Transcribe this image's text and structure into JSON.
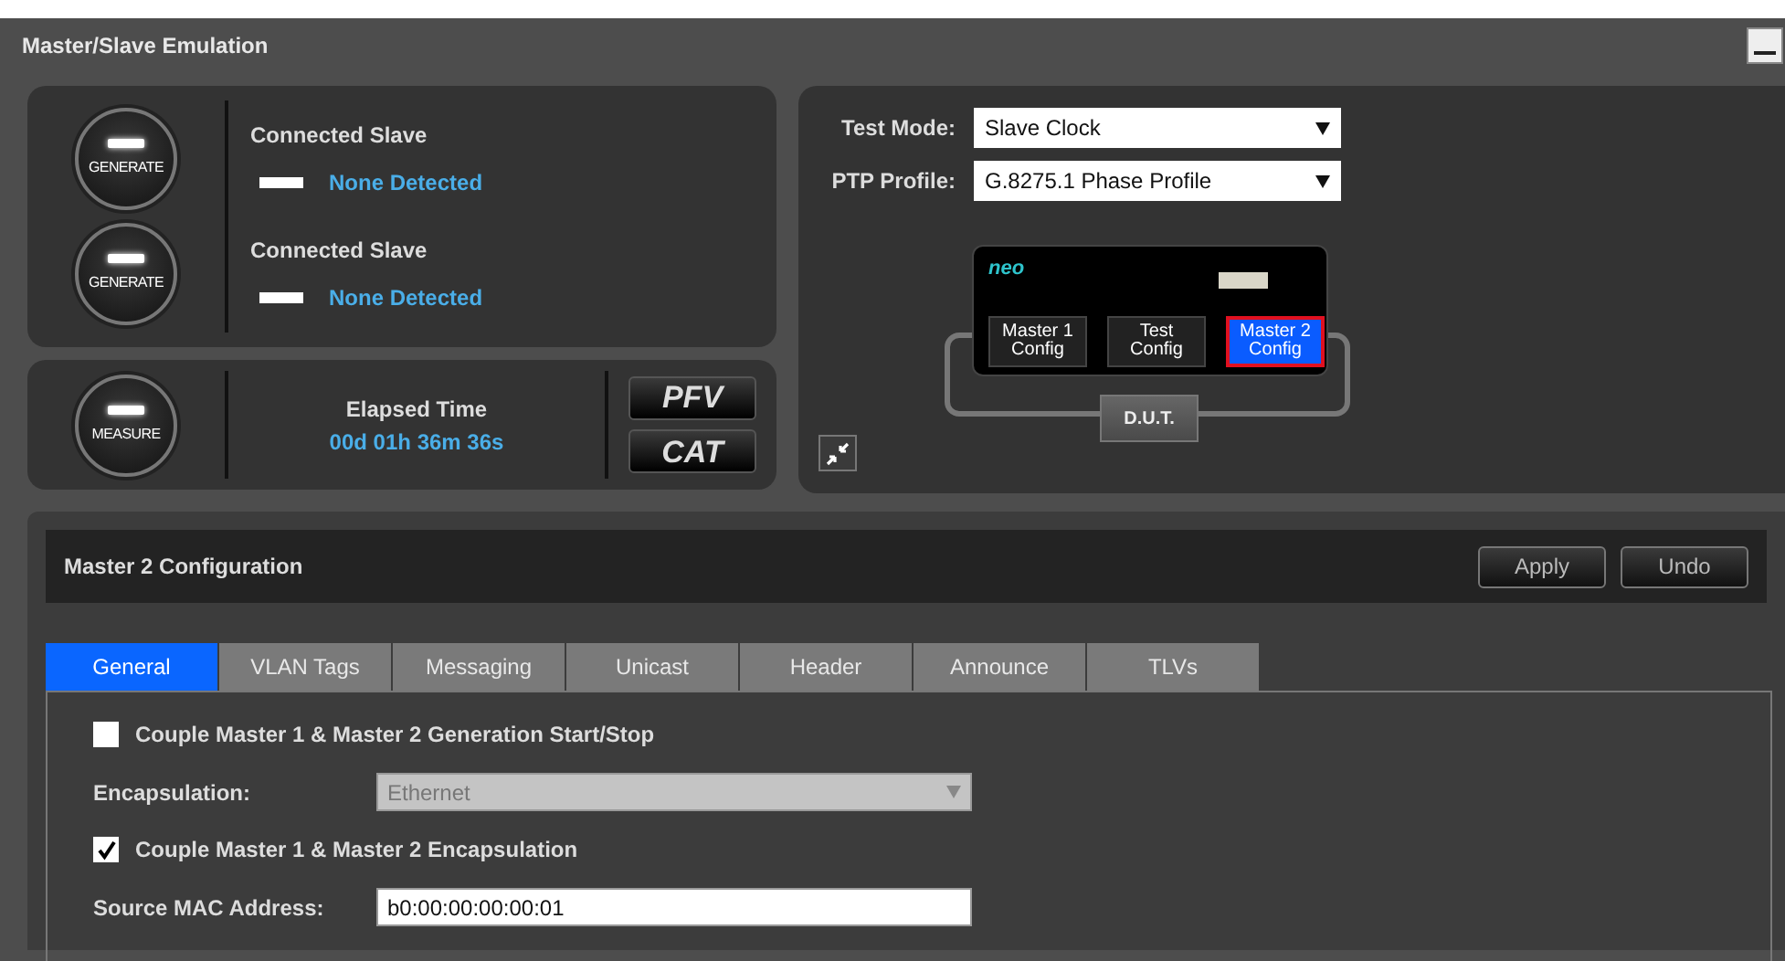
{
  "window": {
    "title": "Master/Slave Emulation"
  },
  "slaves": [
    {
      "button": "GENERATE",
      "heading": "Connected Slave",
      "status": "None Detected",
      "color": "#ffffff"
    },
    {
      "button": "GENERATE",
      "heading": "Connected Slave",
      "status": "None Detected",
      "color": "#ffffff"
    }
  ],
  "measure": {
    "button": "MEASURE",
    "heading": "Elapsed Time",
    "elapsed": "00d 01h 36m 36s"
  },
  "logos": [
    "PFV",
    "CAT"
  ],
  "test_mode": {
    "label": "Test Mode:",
    "value": "Slave Clock"
  },
  "ptp_profile": {
    "label": "PTP Profile:",
    "value": "G.8275.1 Phase Profile"
  },
  "device": {
    "logo": "neo",
    "ports": [
      {
        "label": "Master 1 Config",
        "selected": false
      },
      {
        "label": "Test Config",
        "selected": false
      },
      {
        "label": "Master 2 Config",
        "selected": true
      }
    ],
    "dut": "D.U.T."
  },
  "config": {
    "title": "Master 2 Configuration",
    "buttons": [
      "Apply",
      "Undo"
    ],
    "tabs": [
      {
        "label": "General",
        "selected": true
      },
      {
        "label": "VLAN Tags",
        "selected": false
      },
      {
        "label": "Messaging",
        "selected": false
      },
      {
        "label": "Unicast",
        "selected": false
      },
      {
        "label": "Header",
        "selected": false
      },
      {
        "label": "Announce",
        "selected": false
      },
      {
        "label": "TLVs",
        "selected": false
      }
    ],
    "fields": [
      {
        "kind": "checkbox",
        "label": "Couple Master 1 & Master 2 Generation Start/Stop",
        "checked": false
      },
      {
        "kind": "select",
        "label": "Encapsulation:",
        "value": "Ethernet",
        "disabled": true
      },
      {
        "kind": "checkbox",
        "label": "Couple Master 1 & Master 2 Encapsulation",
        "checked": true
      },
      {
        "kind": "text",
        "label": "Source MAC Address:",
        "value": "b0:00:00:00:00:01"
      }
    ]
  }
}
